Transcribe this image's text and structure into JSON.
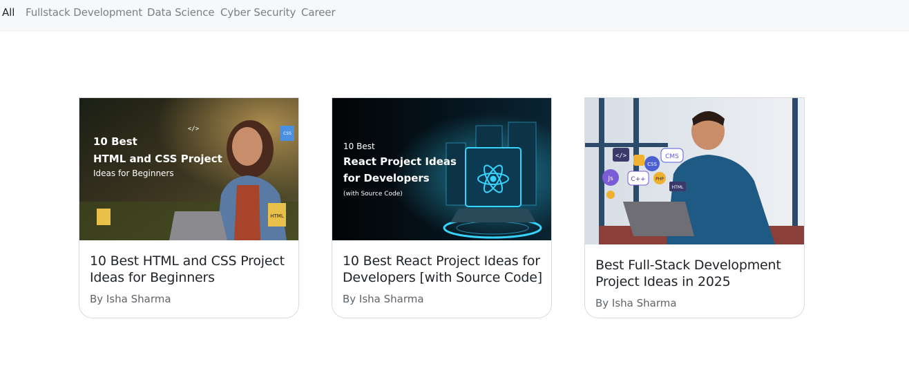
{
  "nav": {
    "tabs": [
      {
        "label": "All",
        "active": true
      },
      {
        "label": "Fullstack Development",
        "active": false
      },
      {
        "label": "Data Science",
        "active": false
      },
      {
        "label": "Cyber Security",
        "active": false
      },
      {
        "label": "Career",
        "active": false
      }
    ]
  },
  "cards": [
    {
      "title": "10 Best HTML and CSS Project Ideas for Beginners",
      "author": "By Isha Sharma",
      "thumb": {
        "line1": "10 Best",
        "line2": "HTML and CSS Project",
        "line3": "Ideas for Beginners",
        "tag_code": "</>",
        "tag_css": "CSS",
        "tag_html": "HTML"
      }
    },
    {
      "title": "10 Best React Project Ideas for Developers [with Source Code]",
      "author": "By Isha Sharma",
      "thumb": {
        "line1": "10 Best",
        "line2": "React Project Ideas",
        "line3": "for Developers",
        "line4": "(with Source Code)"
      }
    },
    {
      "title": "Best Full-Stack Development Project Ideas in 2025",
      "author": "By Isha Sharma",
      "thumb": {
        "badge_code": "</>",
        "badge_css": "CSS",
        "badge_cms": "CMS",
        "badge_js": "Js",
        "badge_cpp": "C++",
        "badge_php": "PHP",
        "badge_html": "HTML"
      }
    }
  ],
  "colors": {
    "nav_bg": "#f7f8f9",
    "nav_active": "#1f2328",
    "nav_inactive": "#7a7f85",
    "card_border": "#d7dbdf",
    "react_cyan": "#37d4ff"
  }
}
